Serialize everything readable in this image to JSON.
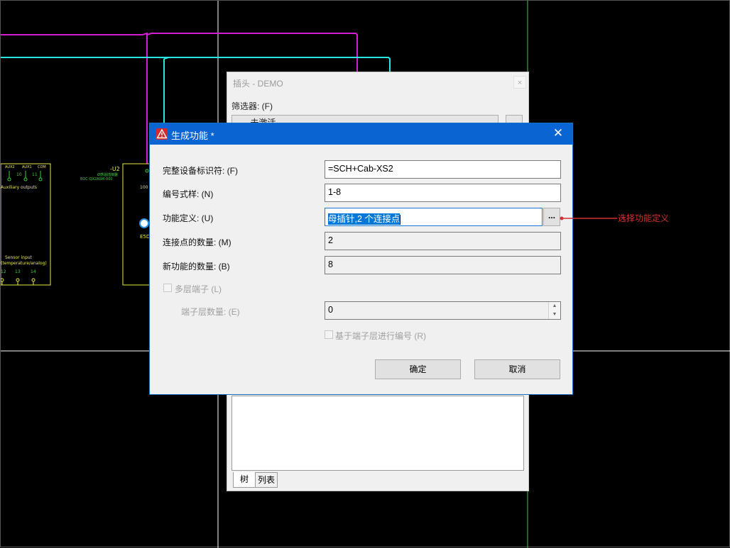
{
  "schematic": {
    "labels": {
      "aux2": "AUX2",
      "aux1": "AUX1",
      "com": "COM",
      "p10": "10",
      "p11": "11",
      "auxiliary_outputs": "Auxiliary outputs",
      "sensor_input": "Sensor input",
      "sensor_sub": "(temperature/analog)",
      "p12": "12",
      "p13": "13",
      "p14": "14",
      "device_id": "-U2",
      "device_desc": "Ø感温插接器",
      "device_part": "BOC-QX2ASM-000",
      "pin_100": "100",
      "device_tag": "E5D"
    }
  },
  "background_dialog": {
    "title": "插头 - DEMO",
    "close_glyph": "×",
    "filter_label": "筛选器: (F)",
    "filter_value": "- 未激活 -",
    "tabs": [
      "树",
      "列表"
    ]
  },
  "dialog": {
    "title": "生成功能 *",
    "close_glyph": "✕",
    "warning_glyph": "⚠",
    "fields": {
      "full_device_tag": {
        "label": "完整设备标识符: (F)",
        "value": "=SCH+Cab-XS2"
      },
      "numbering_pattern": {
        "label": "编号式样: (N)",
        "value": "1-8"
      },
      "function_definition": {
        "label": "功能定义: (U)",
        "value": "母插针,2 个连接点"
      },
      "connection_points": {
        "label": "连接点的数量: (M)",
        "value": "2"
      },
      "new_functions": {
        "label": "新功能的数量: (B)",
        "value": "8"
      },
      "multi_level_terminal": {
        "label": "多层端子 (L)"
      },
      "terminal_levels": {
        "label": "端子层数量: (E)",
        "value": "0"
      },
      "number_by_level": {
        "label": "基于端子层进行编号 (R)"
      }
    },
    "browse_label": "...",
    "ok_label": "确定",
    "cancel_label": "取消"
  },
  "annotation": {
    "text": "选择功能定义"
  },
  "colors": {
    "magenta_wire": "#d21ed2",
    "cyan_wire": "#28e6e6",
    "green_wire": "#3cd23c",
    "yellow_device": "#e8e84a",
    "titlebar_blue": "#0a64d2",
    "annotation_red": "#d63030"
  }
}
